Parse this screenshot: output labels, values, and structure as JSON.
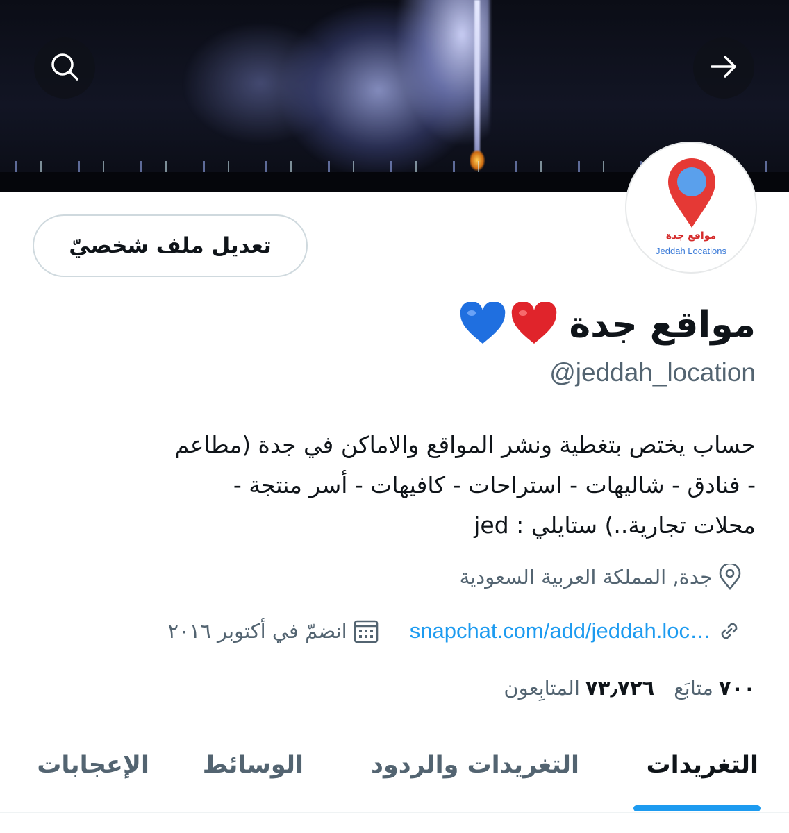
{
  "header": {
    "search_icon": "search-icon",
    "back_icon": "arrow-right-icon"
  },
  "avatar": {
    "logo_text_ar": "مواقع جدة",
    "logo_text_en": "Jeddah Locations",
    "pin_color": "#e53935",
    "dot_color": "#5aa0ec"
  },
  "profile": {
    "edit_button_label": "تعديل ملف شخصيّ",
    "name": "مواقع جدة",
    "name_emojis": [
      "red-heart",
      "blue-heart"
    ],
    "handle": "@jeddah_location",
    "bio_lines": [
      "حساب يختص بتغطية ونشر المواقع والاماكن في جدة (مطاعم",
      "- فنادق - شاليهات - استراحات - كافيهات - أسر منتجة -",
      "محلات تجارية..) ستايلي : jed"
    ],
    "location": "جدة, المملكة العربية السعودية",
    "website": "snapchat.com/add/jeddah.loc…",
    "joined": "انضمّ في أكتوبر ٢٠١٦"
  },
  "stats": {
    "following_count": "٧٠٠",
    "following_label": "متابَع",
    "followers_count": "٧٣٫٧٢٦",
    "followers_label": "المتابِعون"
  },
  "tabs": {
    "tweets": "التغريدات",
    "replies": "التغريدات والردود",
    "media": "الوسائط",
    "likes": "الإعجابات"
  },
  "colors": {
    "accent": "#1d9bf0",
    "muted": "#536471",
    "text": "#0f1419"
  }
}
